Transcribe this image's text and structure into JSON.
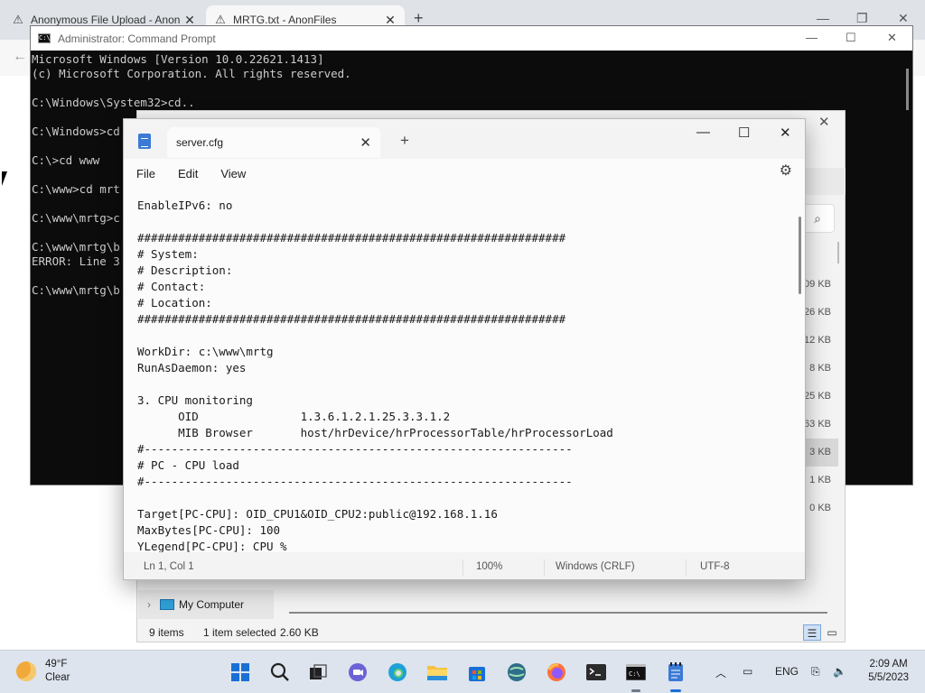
{
  "browser": {
    "tabs": [
      {
        "label": "Anonymous File Upload - Anon",
        "active": false
      },
      {
        "label": "MRTG.txt - AnonFiles",
        "active": true
      }
    ],
    "new_tab": "+"
  },
  "cmd": {
    "title": "Administrator: Command Prompt",
    "lines": [
      "Microsoft Windows [Version 10.0.22621.1413]",
      "(c) Microsoft Corporation. All rights reserved.",
      "",
      "C:\\Windows\\System32>cd..",
      "",
      "C:\\Windows>cd",
      "",
      "C:\\>cd www",
      "",
      "C:\\www>cd mrt",
      "",
      "C:\\www\\mrtg>c",
      "",
      "C:\\www\\mrtg\\b",
      "ERROR: Line 3",
      "",
      "C:\\www\\mrtg\\b"
    ]
  },
  "explorer": {
    "sizes": [
      "09 KB",
      "26 KB",
      "12 KB",
      "8 KB",
      "25 KB",
      "63 KB",
      "3 KB",
      "1 KB",
      "0 KB"
    ],
    "selected_index": 6,
    "tree_item": "My Computer",
    "status": {
      "items": "9 items",
      "selected": "1 item selected",
      "size": "2.60 KB"
    }
  },
  "notepad": {
    "tab_title": "server.cfg",
    "menu": {
      "file": "File",
      "edit": "Edit",
      "view": "View"
    },
    "content_lines": [
      "EnableIPv6: no",
      "",
      "###############################################################",
      "# System:",
      "# Description:",
      "# Contact:",
      "# Location:",
      "###############################################################",
      "",
      "WorkDir: c:\\www\\mrtg",
      "RunAsDaemon: yes",
      "",
      "3. CPU monitoring",
      "      OID               1.3.6.1.2.1.25.3.3.1.2",
      "      MIB Browser       host/hrDevice/hrProcessorTable/hrProcessorLoad",
      "#---------------------------------------------------------------",
      "# PC - CPU load",
      "#---------------------------------------------------------------",
      "",
      "Target[PC-CPU]: OID_CPU1&OID_CPU2:public@192.168.1.16",
      "MaxBytes[PC-CPU]: 100",
      "YLegend[PC-CPU]: CPU %"
    ],
    "status": {
      "position": "Ln 1, Col 1",
      "zoom": "100%",
      "line_ending": "Windows (CRLF)",
      "encoding": "UTF-8"
    }
  },
  "taskbar": {
    "weather": {
      "temp": "49°F",
      "condition": "Clear"
    },
    "language": "ENG",
    "time": "2:09 AM",
    "date": "5/5/2023"
  },
  "colors": {
    "accent": "#1a6fd6",
    "cmd_bg": "#0c0c0c",
    "cmd_fg": "#cccccc"
  }
}
